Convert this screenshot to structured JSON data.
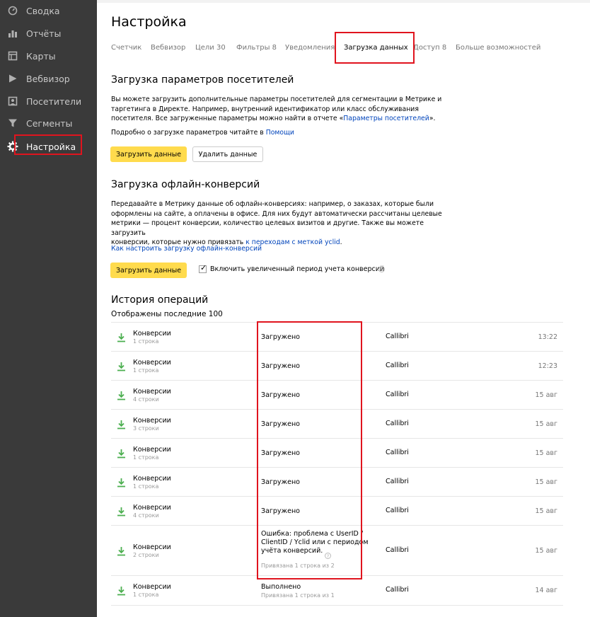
{
  "sidebar": {
    "items": [
      {
        "label": "Сводка",
        "icon": "gauge-icon"
      },
      {
        "label": "Отчёты",
        "icon": "bar-chart-icon"
      },
      {
        "label": "Карты",
        "icon": "map-icon"
      },
      {
        "label": "Вебвизор",
        "icon": "play-icon"
      },
      {
        "label": "Посетители",
        "icon": "visitors-icon"
      },
      {
        "label": "Сегменты",
        "icon": "filter-icon"
      },
      {
        "label": "Настройка",
        "icon": "gear-icon"
      }
    ]
  },
  "page": {
    "title": "Настройка",
    "tabs": [
      "Счетчик",
      "Вебвизор",
      "Цели 30",
      "Фильтры 8",
      "Уведомления",
      "Загрузка данных",
      "Доступ 8",
      "Больше возможностей"
    ],
    "active_tab": "Загрузка данных"
  },
  "params_section": {
    "title": "Загрузка параметров посетителей",
    "text_line1": "Вы можете загрузить дополнительные параметры посетителей для сегментации в Метрике и",
    "text_line2": "таргетинга в Директе. Например, внутренний идентификатор или класс обслуживания",
    "text_line3_pre": "посетителя. Все загруженные параметры можно найти в отчете «",
    "text_line3_link": "Параметры посетителей",
    "text_line3_post": "».",
    "help_pre": "Подробно о загрузке параметров читайте в ",
    "help_link": "Помощи",
    "upload_button": "Загрузить данные",
    "delete_button": "Удалить данные"
  },
  "offline_section": {
    "title": "Загрузка офлайн-конверсий",
    "text_line1": "Передавайте в Метрику данные об офлайн-конверсиях: например, о заказах, которые были",
    "text_line2": "оформлены на сайте, а оплачены в офисе. Для них будут автоматически рассчитаны целевые",
    "text_line3": "метрики — процент конверсии, количество целевых визитов и другие. Также вы можете загрузить",
    "text_line4_pre": "конверсии, которые нужно привязать ",
    "text_line4_link": "к переходам с меткой yclid",
    "text_line4_post": ".",
    "howto_link": "Как настроить загрузку офлайн-конверсий",
    "upload_button": "Загрузить данные",
    "checkbox_label": "Включить увеличенный период учета конверсий",
    "checkbox_checked": true,
    "help_glyph": "?"
  },
  "history": {
    "title": "История операций",
    "subtitle": "Отображены последние 100",
    "rows": [
      {
        "name": "Конверсии",
        "count": "1 строка",
        "status": "Загружено",
        "status_sub": "",
        "counter": "Callibri",
        "time": "13:22"
      },
      {
        "name": "Конверсии",
        "count": "1 строка",
        "status": "Загружено",
        "status_sub": "",
        "counter": "Callibri",
        "time": "12:23"
      },
      {
        "name": "Конверсии",
        "count": "4 строки",
        "status": "Загружено",
        "status_sub": "",
        "counter": "Callibri",
        "time": "15 авг"
      },
      {
        "name": "Конверсии",
        "count": "3 строки",
        "status": "Загружено",
        "status_sub": "",
        "counter": "Callibri",
        "time": "15 авг"
      },
      {
        "name": "Конверсии",
        "count": "1 строка",
        "status": "Загружено",
        "status_sub": "",
        "counter": "Callibri",
        "time": "15 авг"
      },
      {
        "name": "Конверсии",
        "count": "1 строка",
        "status": "Загружено",
        "status_sub": "",
        "counter": "Callibri",
        "time": "15 авг"
      },
      {
        "name": "Конверсии",
        "count": "4 строки",
        "status": "Загружено",
        "status_sub": "",
        "counter": "Callibri",
        "time": "15 авг"
      },
      {
        "name": "Конверсии",
        "count": "2 строки",
        "status_line1": "Ошибка: проблема с UserID /",
        "status_line2": "ClientID / Yclid или с периодом",
        "status_line3": "учёта конверсий.",
        "status_sub": "Привязана 1 строка из 2",
        "counter": "Callibri",
        "time": "15 авг"
      },
      {
        "name": "Конверсии",
        "count": "1 строка",
        "status": "Выполнено",
        "status_sub": "Привязана 1 строка из 1",
        "counter": "Callibri",
        "time": "14 авг"
      }
    ]
  },
  "colors": {
    "sidebar_bg": "#3a3a3a",
    "accent_yellow": "#ffdb4d",
    "link_blue": "#0044bb",
    "download_green": "#4caf50",
    "highlight_red": "#e0141e"
  }
}
